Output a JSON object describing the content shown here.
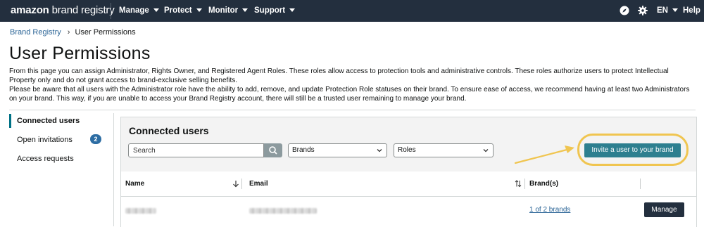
{
  "header": {
    "brand_bold": "amazon",
    "brand_rest": " brand registry",
    "menus": [
      {
        "label": "Manage"
      },
      {
        "label": "Protect"
      },
      {
        "label": "Monitor"
      },
      {
        "label": "Support"
      }
    ],
    "language": "EN",
    "help": "Help",
    "icons": [
      "compass-icon",
      "gear-icon"
    ]
  },
  "breadcrumb": {
    "home": "Brand Registry",
    "current": "User Permissions"
  },
  "page": {
    "title": "User Permissions",
    "desc1": "From this page you can assign Administrator, Rights Owner, and Registered Agent Roles. These roles allow access to protection tools and administrative controls. These roles authorize users to protect Intellectual Property only and do not grant access to brand-exclusive selling benefits.",
    "desc2": "Please be aware that all users with the Administrator role have the ability to add, remove, and update Protection Role statuses on their brand. To ensure ease of access, we recommend having at least two Administrators on your brand. This way, if you are unable to access your Brand Registry account, there will still be a trusted user remaining to manage your brand."
  },
  "sidebar": {
    "items": [
      {
        "label": "Connected users",
        "active": true
      },
      {
        "label": "Open invitations",
        "badge": "2"
      },
      {
        "label": "Access requests"
      }
    ]
  },
  "panel": {
    "title": "Connected users",
    "search_placeholder": "Search",
    "brands_select": "Brands",
    "roles_select": "Roles",
    "invite_label": "Invite a user to your brand"
  },
  "table": {
    "columns": [
      "Name",
      "Email",
      "Brand(s)"
    ],
    "rows": [
      {
        "brands_link": "1 of 2 brands",
        "action": "Manage"
      }
    ]
  },
  "colors": {
    "nav_bg": "#232f3e",
    "accent": "#2d7f8f",
    "highlight": "#f0c550",
    "link": "#2a6496"
  }
}
